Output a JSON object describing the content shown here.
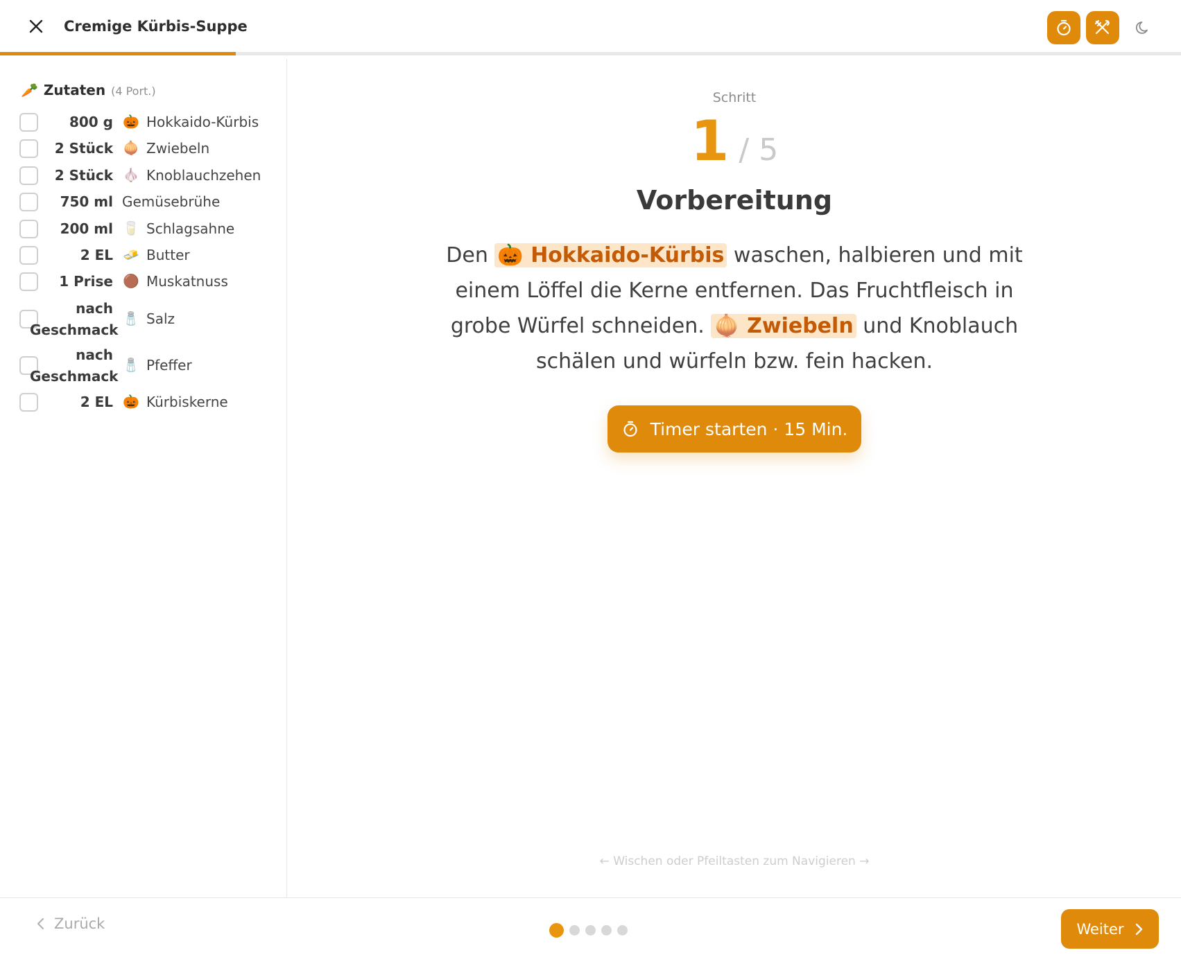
{
  "header": {
    "title": "Cremige Kürbis-Suppe",
    "progress_fraction": 0.2,
    "accent": "#e08a0b"
  },
  "ingredients": {
    "heading": "Zutaten",
    "portions": "(4 Port.)",
    "items": [
      {
        "qty": "800 g",
        "icon": "🎃",
        "name": "Hokkaido-Kürbis"
      },
      {
        "qty": "2 Stück",
        "icon": "🧅",
        "name": "Zwiebeln"
      },
      {
        "qty": "2 Stück",
        "icon": "🧄",
        "name": "Knoblauchzehen"
      },
      {
        "qty": "750 ml",
        "icon": "",
        "name": "Gemüsebrühe"
      },
      {
        "qty": "200 ml",
        "icon": "🥛",
        "name": "Schlagsahne"
      },
      {
        "qty": "2 EL",
        "icon": "🧈",
        "name": "Butter"
      },
      {
        "qty": "1 Prise",
        "icon": "🟤",
        "name": "Muskatnuss"
      },
      {
        "qty": "nach Geschmack",
        "icon": "🧂",
        "name": "Salz"
      },
      {
        "qty": "nach Geschmack",
        "icon": "🧂",
        "name": "Pfeffer"
      },
      {
        "qty": "2 EL",
        "icon": "🎃",
        "name": "Kürbiskerne"
      }
    ]
  },
  "step": {
    "label": "Schritt",
    "current": "1",
    "total": "/ 5",
    "title": "Vorbereitung",
    "text": {
      "p1": "Den",
      "hl1": "🎃 Hokkaido-Kürbis",
      "p2": "waschen, halbieren und mit einem Löffel die Kerne entfernen. Das Fruchtfleisch in grobe Würfel schneiden.",
      "hl2": "🧅 Zwiebeln",
      "p3": "und Knoblauch schälen und würfeln bzw. fein hacken."
    },
    "timer_label": "Timer starten · 15 Min."
  },
  "hint": "← Wischen oder Pfeiltasten zum Navigieren →",
  "footer": {
    "back_label": "Zurück",
    "next_label": "Weiter",
    "dots_total": 5,
    "dots_active": 0
  }
}
